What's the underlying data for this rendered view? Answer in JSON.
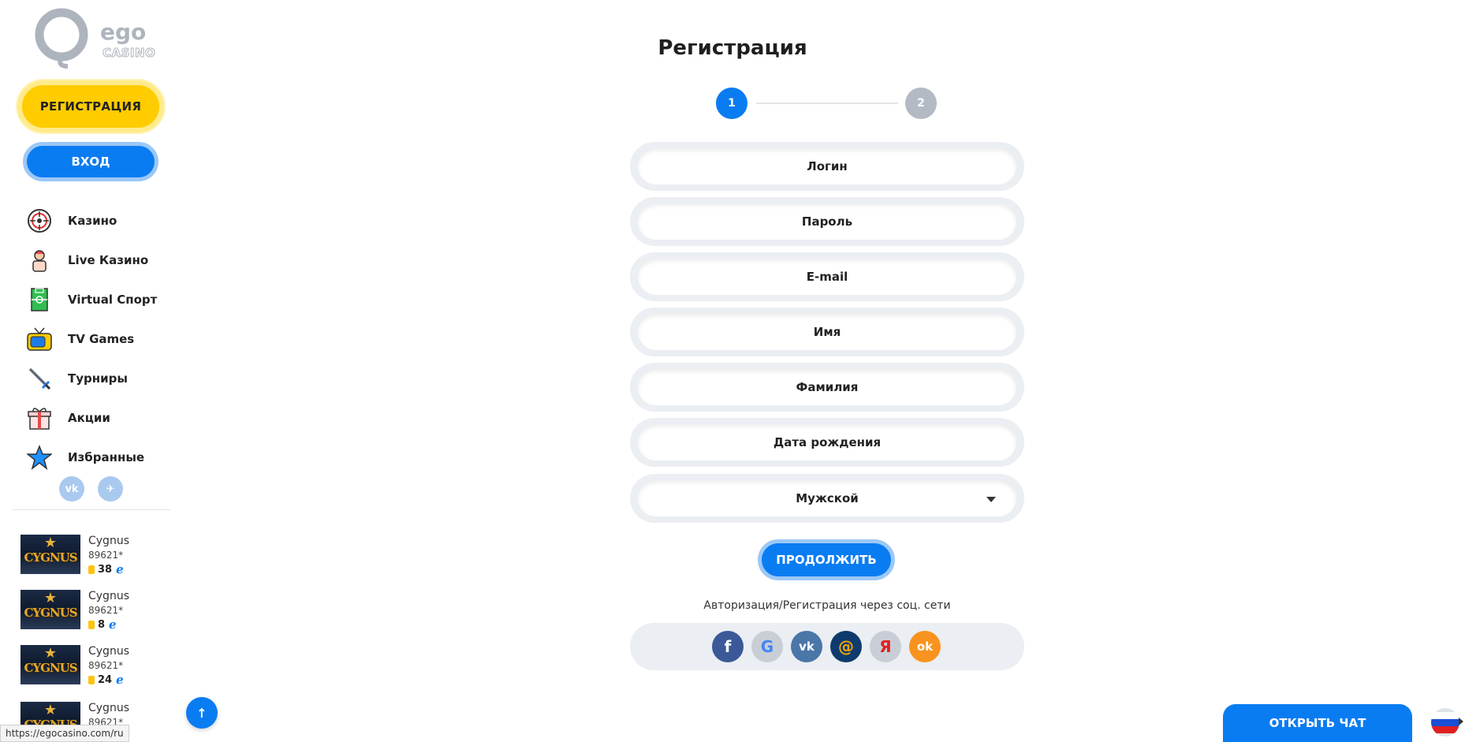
{
  "logo": {
    "text": "ego",
    "sub": "CASINO"
  },
  "sidebar": {
    "register_label": "РЕГИСТРАЦИЯ",
    "login_label": "ВХОД",
    "items": [
      {
        "label": "Казино",
        "icon": "roulette-icon"
      },
      {
        "label": "Live Казино",
        "icon": "dealer-icon"
      },
      {
        "label": "Virtual Спорт",
        "icon": "field-icon"
      },
      {
        "label": "TV Games",
        "icon": "tv-icon"
      },
      {
        "label": "Турниры",
        "icon": "sword-icon"
      },
      {
        "label": "Акции",
        "icon": "gift-icon"
      },
      {
        "label": "Избранные",
        "icon": "star-icon"
      }
    ],
    "social": [
      {
        "label": "vk",
        "icon": "vk-icon"
      },
      {
        "label": "✈",
        "icon": "telegram-icon"
      }
    ],
    "winners": [
      {
        "game": "Cygnus",
        "user": "89621*",
        "amount": "38",
        "thumb": "CYGNUS"
      },
      {
        "game": "Cygnus",
        "user": "89621*",
        "amount": "8",
        "thumb": "CYGNUS"
      },
      {
        "game": "Cygnus",
        "user": "89621*",
        "amount": "24",
        "thumb": "CYGNUS"
      },
      {
        "game": "Cygnus",
        "user": "89621*",
        "amount": "",
        "thumb": "CYGNUS"
      }
    ]
  },
  "status_url": "https://egocasino.com/ru",
  "form": {
    "title": "Регистрация",
    "steps": [
      "1",
      "2"
    ],
    "fields": {
      "login": "Логин",
      "password": "Пароль",
      "email": "E-mail",
      "first_name": "Имя",
      "last_name": "Фамилия",
      "birth_date": "Дата рождения",
      "gender": "Мужской"
    },
    "continue_label": "ПРОДОЛЖИТЬ",
    "social_caption": "Авторизация/Регистрация через соц. сети",
    "social": [
      {
        "name": "facebook-icon",
        "glyph": "f",
        "color": "#3b5998"
      },
      {
        "name": "google-icon",
        "glyph": "G",
        "color": "#c9ced6"
      },
      {
        "name": "vk-icon",
        "glyph": "vk",
        "color": "#4a76a8"
      },
      {
        "name": "mail-icon",
        "glyph": "@",
        "color": "#168de2"
      },
      {
        "name": "yandex-icon",
        "glyph": "Я",
        "color": "#c9ced6"
      },
      {
        "name": "odnoklassniki-icon",
        "glyph": "ok",
        "color": "#f7931e"
      }
    ]
  },
  "chat_label": "ОТКРЫТЬ ЧАТ",
  "colors": {
    "accent": "#0a7cf2",
    "brand_yellow": "#ffcc00",
    "field_bg": "#ebeef2"
  }
}
